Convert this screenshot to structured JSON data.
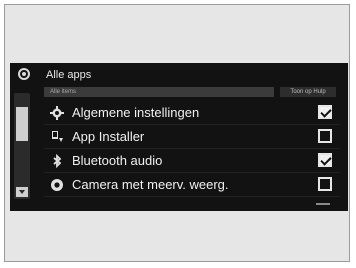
{
  "header": {
    "title": "Alle apps"
  },
  "subbar": {
    "sort_label": "Alle items",
    "show_label": "Toon op Hulp"
  },
  "apps": [
    {
      "label": "Algemene instellingen",
      "icon": "gear-icon",
      "checked": true
    },
    {
      "label": "App Installer",
      "icon": "app-installer-icon",
      "checked": false
    },
    {
      "label": "Bluetooth audio",
      "icon": "bluetooth-icon",
      "checked": true
    },
    {
      "label": "Camera met meerv. weerg.",
      "icon": "camera-icon",
      "checked": false
    }
  ]
}
